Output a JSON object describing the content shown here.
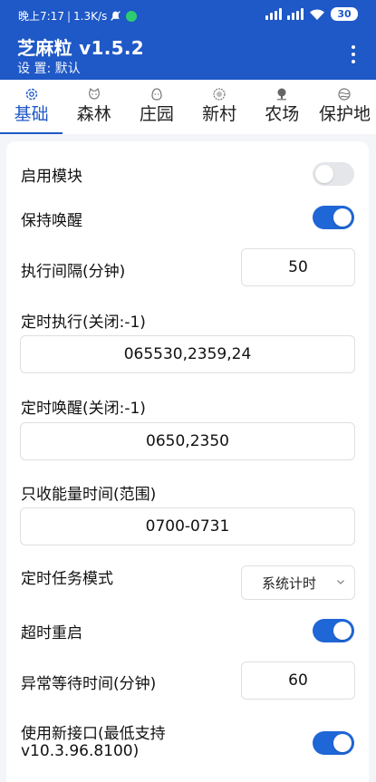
{
  "status_bar": {
    "time": "晚上7:17",
    "speed": "1.3K/s",
    "battery": "30"
  },
  "header": {
    "title": "芝麻粒 v1.5.2",
    "subtitle": "设 置: 默认"
  },
  "tabs": [
    {
      "label": "基础",
      "icon": "gear-icon",
      "active": true
    },
    {
      "label": "森林",
      "icon": "cat-icon",
      "active": false
    },
    {
      "label": "庄园",
      "icon": "chick-icon",
      "active": false
    },
    {
      "label": "新村",
      "icon": "sticker-icon",
      "active": false
    },
    {
      "label": "农场",
      "icon": "tree-icon",
      "active": false
    },
    {
      "label": "保护地",
      "icon": "globe-icon",
      "active": false
    }
  ],
  "settings": {
    "enable_module": {
      "label": "启用模块",
      "on": false
    },
    "keep_awake": {
      "label": "保持唤醒",
      "on": true
    },
    "interval": {
      "label": "执行间隔(分钟)",
      "value": "50"
    },
    "timed_exec": {
      "label": "定时执行(关闭:-1)",
      "value": "065530,2359,24"
    },
    "timed_wake": {
      "label": "定时唤醒(关闭:-1)",
      "value": "0650,2350"
    },
    "energy_time": {
      "label": "只收能量时间(范围)",
      "value": "0700-0731"
    },
    "task_mode": {
      "label": "定时任务模式",
      "value": "系统计时"
    },
    "timeout_restart": {
      "label": "超时重启",
      "on": true
    },
    "error_wait": {
      "label": "异常等待时间(分钟)",
      "value": "60"
    },
    "new_api": {
      "label_line1": "使用新接口(最低支持",
      "label_line2": "v10.3.96.8100)",
      "on": true
    }
  }
}
